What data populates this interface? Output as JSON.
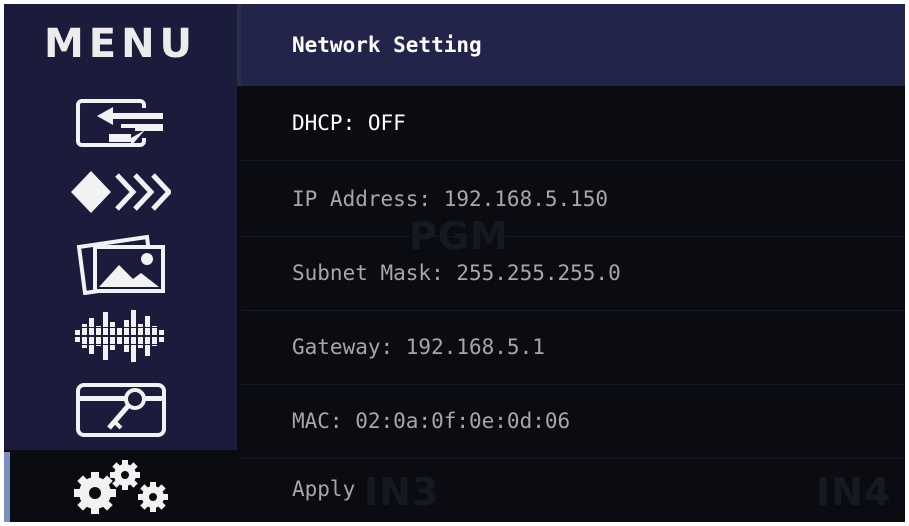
{
  "sidebar": {
    "title": "MENU",
    "items": [
      {
        "icon": "input-switch-icon"
      },
      {
        "icon": "transition-icon"
      },
      {
        "icon": "picture-icon"
      },
      {
        "icon": "audio-icon"
      },
      {
        "icon": "key-card-icon"
      },
      {
        "icon": "settings-icon",
        "selected": true
      }
    ]
  },
  "network": {
    "header": "Network Setting",
    "dhcp": "DHCP: OFF",
    "ip": "IP Address: 192.168.5.150",
    "subnet": "Subnet Mask: 255.255.255.0",
    "gateway": "Gateway: 192.168.5.1",
    "mac": "MAC: 02:0a:0f:0e:0d:06",
    "apply": "Apply"
  },
  "background_preview": {
    "pgm_label": "PGM",
    "in3_label": "IN3",
    "in4_label": "IN4"
  },
  "colors": {
    "sidebar": "#1b1c3c",
    "header": "#23244a",
    "background": "#0b0c11",
    "text_active": "#ffffff",
    "text_dim": "#a6a7ac",
    "selection": "#7b8ec0"
  }
}
